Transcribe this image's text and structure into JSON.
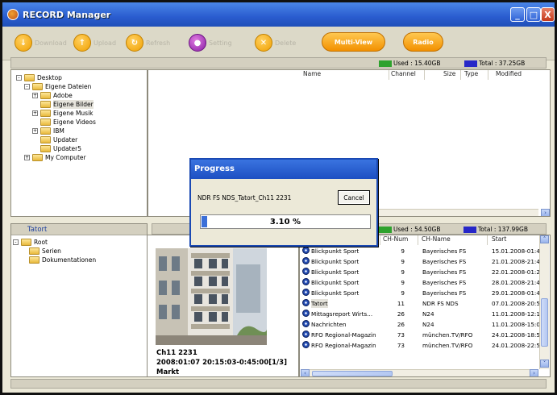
{
  "app": {
    "title": "RECORD Manager",
    "icon": "app-icon"
  },
  "window_controls": {
    "minimize": "_",
    "maximize": "□",
    "close": "X"
  },
  "toolbar": {
    "download": "Download",
    "upload": "Upload",
    "refresh": "Refresh",
    "setting": "Setting",
    "delete": "Delete",
    "multiview": "Multi-View",
    "radio": "Radio"
  },
  "disk_top": {
    "used": "Used : 15.40GB",
    "total": "Total : 37.25GB"
  },
  "disk_bottom": {
    "used": "Used : 54.50GB",
    "total": "Total : 137.99GB"
  },
  "colors": {
    "used": "#2ea22e",
    "total": "#2727c8",
    "accent": "#1d4fc2"
  },
  "tree_top": [
    {
      "label": "Desktop",
      "toggle": "-"
    },
    {
      "label": "Eigene Dateien",
      "toggle": "-"
    },
    {
      "label": "Adobe",
      "toggle": "+"
    },
    {
      "label": "Eigene Bilder",
      "toggle": ""
    },
    {
      "label": "Eigene Musik",
      "toggle": "+"
    },
    {
      "label": "Eigene Videos",
      "toggle": ""
    },
    {
      "label": "IBM",
      "toggle": "+"
    },
    {
      "label": "Updater",
      "toggle": ""
    },
    {
      "label": "Updater5",
      "toggle": ""
    },
    {
      "label": "My Computer",
      "toggle": "+"
    }
  ],
  "file_columns": {
    "name": "Name",
    "channel": "Channel",
    "size": "Size",
    "type": "Type",
    "modified": "Modified"
  },
  "bottom_left": {
    "header": "Tatort"
  },
  "tree_bottom": [
    {
      "label": "Root",
      "toggle": "-"
    },
    {
      "label": "Serien",
      "toggle": ""
    },
    {
      "label": "Dokumentationen",
      "toggle": ""
    }
  ],
  "recording_columns": {
    "num": "CH-Num",
    "name": "CH-Name",
    "start": "Start"
  },
  "recordings": [
    {
      "title": "Blickpunkt Sport",
      "num": "9",
      "channel": "Bayerisches FS",
      "start": "15.01.2008-01:4"
    },
    {
      "title": "Blickpunkt Sport",
      "num": "9",
      "channel": "Bayerisches FS",
      "start": "21.01.2008-21:4"
    },
    {
      "title": "Blickpunkt Sport",
      "num": "9",
      "channel": "Bayerisches FS",
      "start": "22.01.2008-01:2"
    },
    {
      "title": "Blickpunkt Sport",
      "num": "9",
      "channel": "Bayerisches FS",
      "start": "28.01.2008-21:4"
    },
    {
      "title": "Blickpunkt Sport",
      "num": "9",
      "channel": "Bayerisches FS",
      "start": "29.01.2008-01:4"
    },
    {
      "title": "Tatort",
      "num": "11",
      "channel": "NDR FS NDS",
      "start": "07.01.2008-20:5"
    },
    {
      "title": "Mittagsreport Wirts...",
      "num": "26",
      "channel": "N24",
      "start": "11.01.2008-12:1"
    },
    {
      "title": "Nachrichten",
      "num": "26",
      "channel": "N24",
      "start": "11.01.2008-15:0"
    },
    {
      "title": "RFO Regional-Magazin",
      "num": "73",
      "channel": "münchen.TV/RFO",
      "start": "24.01.2008-18:5"
    },
    {
      "title": "RFO Regional-Magazin",
      "num": "73",
      "channel": "münchen.TV/RFO",
      "start": "24.01.2008-22:5"
    }
  ],
  "preview": {
    "line1": "Ch11 2231",
    "line2": "2008:01:07 20:15:03-0:45:00[1/3]",
    "line3": "Markt"
  },
  "progress": {
    "title": "Progress",
    "file": "NDR FS NDS_Tatort_Ch11 2231",
    "cancel": "Cancel",
    "percent_text": "3.10 %",
    "percent": 3.1
  }
}
